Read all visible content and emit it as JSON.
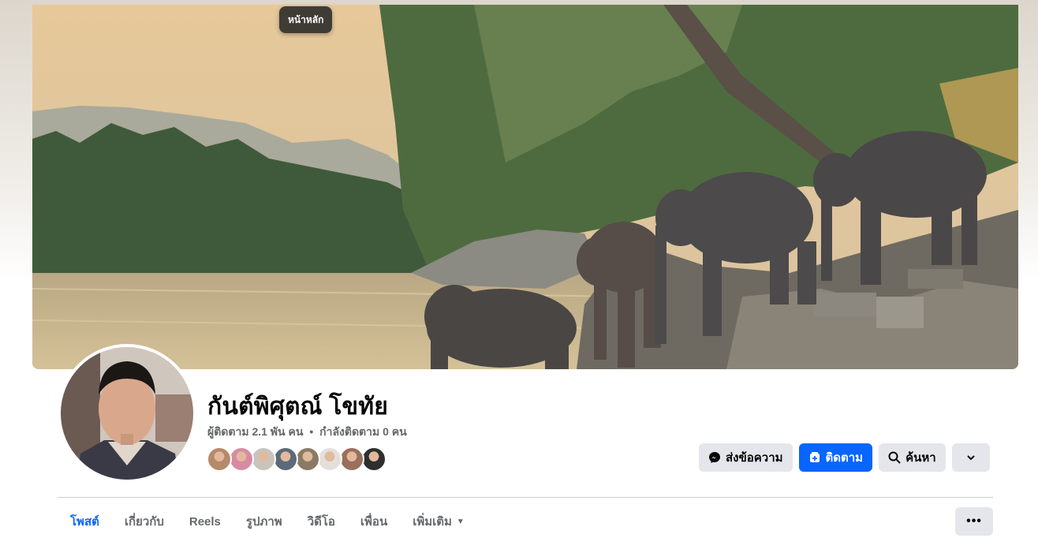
{
  "tooltip": {
    "text": "หน้าหลัก"
  },
  "profile": {
    "name": "กันต์พิศุตณ์ โขทัย",
    "followers_text": "ผู้ติดตาม 2.1 พัน คน",
    "separator": "•",
    "following_text": "กำลังติดตาม 0 คน"
  },
  "friend_faces": [
    {
      "color": "#b58a6a"
    },
    {
      "color": "#d88aa3"
    },
    {
      "color": "#c9c3bd"
    },
    {
      "color": "#5b6a7a"
    },
    {
      "color": "#8a7a64"
    },
    {
      "color": "#e3e0da"
    },
    {
      "color": "#9a6f5c"
    },
    {
      "color": "#2f2f2f"
    }
  ],
  "actions": {
    "message_label": "ส่งข้อความ",
    "follow_label": "ติดตาม",
    "search_label": "ค้นหา"
  },
  "tabs": [
    {
      "label": "โพสต์",
      "active": true
    },
    {
      "label": "เกี่ยวกับ",
      "active": false
    },
    {
      "label": "Reels",
      "active": false
    },
    {
      "label": "รูปภาพ",
      "active": false
    },
    {
      "label": "วิดีโอ",
      "active": false
    },
    {
      "label": "เพื่อน",
      "active": false
    },
    {
      "label": "เพิ่มเติม",
      "active": false,
      "dropdown": true
    }
  ],
  "more_options_label": "•••",
  "colors": {
    "accent": "#0866ff",
    "button_grey": "#e4e6eb",
    "muted_text": "#65676b"
  }
}
